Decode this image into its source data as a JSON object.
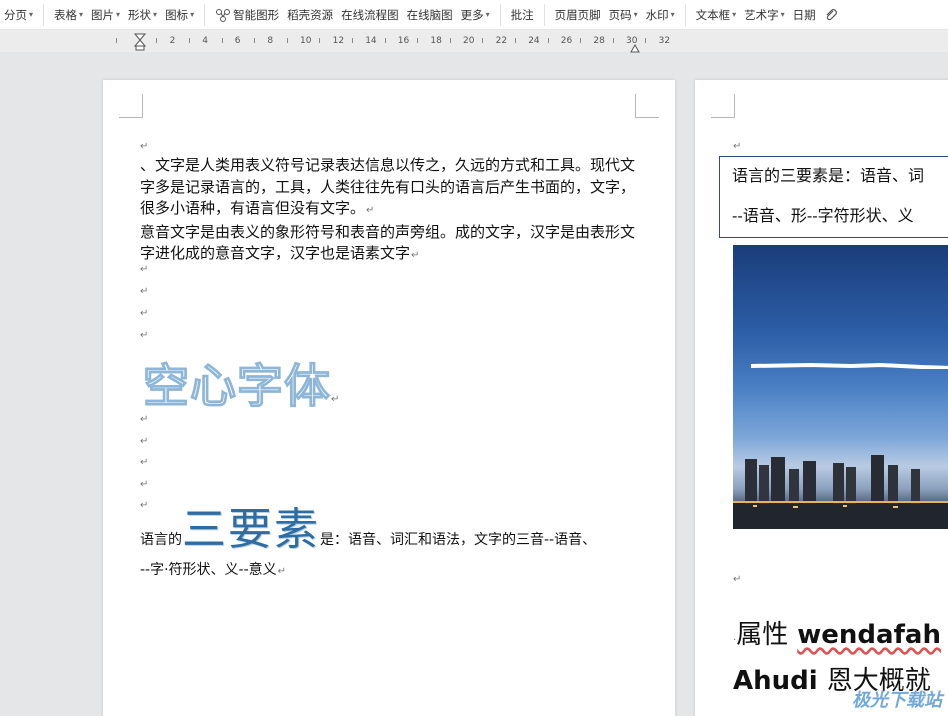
{
  "toolbar": {
    "items": [
      {
        "label": "分页",
        "caret": true
      },
      {
        "label": "表格",
        "caret": true
      },
      {
        "label": "图片",
        "caret": true
      },
      {
        "label": "形状",
        "caret": true
      },
      {
        "label": "图标",
        "caret": true
      },
      {
        "label": "智能图形",
        "caret": false,
        "icon": "smart-graphic-icon"
      },
      {
        "label": "稻壳资源",
        "caret": false
      },
      {
        "label": "在线流程图",
        "caret": false
      },
      {
        "label": "在线脑图",
        "caret": false
      },
      {
        "label": "更多",
        "caret": true
      },
      {
        "label": "批注",
        "caret": false
      },
      {
        "label": "页眉页脚",
        "caret": false
      },
      {
        "label": "页码",
        "caret": true
      },
      {
        "label": "水印",
        "caret": true
      },
      {
        "label": "文本框",
        "caret": true
      },
      {
        "label": "艺术字",
        "caret": true
      },
      {
        "label": "日期",
        "caret": false
      }
    ],
    "caret_glyph": "▾",
    "attachment_icon": "paperclip-icon"
  },
  "ruler": {
    "numbers": [
      "2",
      "4",
      "6",
      "8",
      "10",
      "12",
      "14",
      "16",
      "18",
      "20",
      "22",
      "24",
      "26",
      "28",
      "30",
      "32"
    ]
  },
  "page1": {
    "para_mark": "↵",
    "paragraphs": [
      "、文字是人类用表义符号记录表达信息以传之，久远的方式和工具。现代文字多是记录语言的，工具，人类往往先有口头的语言后产生书面的，文字，很多小语种，有语言但没有文字。",
      "意音文字是由表义的象形符号和表音的声旁组。成的文字，汉字是由表形文字进化成的意音文字，汉字也是语素文字"
    ],
    "hollow_title": "空心字体",
    "three_line": {
      "prefix": "语言的",
      "big": "三要素",
      "suffix": "是：语音、词汇和语法，文字的三音--语音、",
      "line2": "--字·符形状、义--意义"
    }
  },
  "page2": {
    "para_mark": "↵",
    "textbox_line1": "语言的三要素是：语音、词",
    "textbox_line2": "--语音、形--字符形状、义",
    "prop_line1_cn": "属性",
    "prop_line1_en": "wendafah",
    "prop_line2_en": "Ahudi",
    "prop_line2_cn": "恩大概就",
    "watermark": "极光下载站"
  },
  "colors": {
    "hollow_stroke": "#8db6d8",
    "big_three": "#2e6ca4",
    "textbox_border": "#2e4a8a"
  }
}
